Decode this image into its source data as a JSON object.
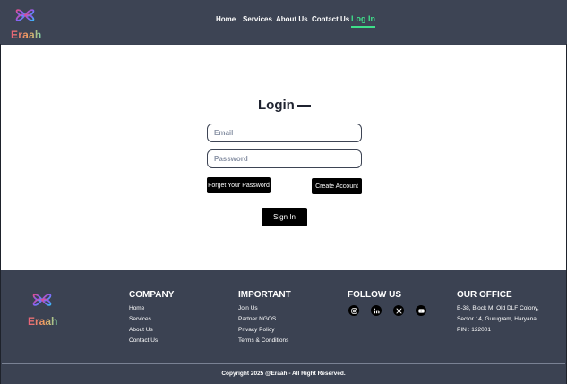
{
  "brand": {
    "name": "Eraah"
  },
  "nav": {
    "items": [
      {
        "label": "Home"
      },
      {
        "label": "Services"
      },
      {
        "label": "About Us"
      },
      {
        "label": "Contact Us"
      },
      {
        "label": "Log In",
        "active": true
      }
    ]
  },
  "login": {
    "title": "Login",
    "email_placeholder": "Email",
    "password_placeholder": "Password",
    "forgot_label": "Forget Your Password",
    "create_label": "Create Account",
    "signin_label": "Sign In"
  },
  "footer": {
    "company": {
      "heading": "COMPANY",
      "links": [
        "Home",
        "Services",
        "About Us",
        "Contact Us"
      ]
    },
    "important": {
      "heading": "IMPORTANT",
      "links": [
        "Join Us",
        "Partner NGOS",
        "Privacy Policy",
        "Terms & Conditions"
      ]
    },
    "follow": {
      "heading": "FOLLOW US",
      "icons": [
        "instagram-icon",
        "linkedin-icon",
        "x-icon",
        "youtube-icon"
      ]
    },
    "office": {
      "heading": "OUR OFFICE",
      "lines": [
        "B-38, Block M, Old DLF Colony,",
        "Sector 14, Gurugram, Haryana",
        "PIN : 122001"
      ]
    },
    "copyright": "Copyright 2025 @Eraah - All Right Reserved."
  },
  "colors": {
    "header_bg": "#3d4454",
    "footer_bg": "#3b4252",
    "accent": "#3fe08a",
    "button_bg": "#000000"
  }
}
